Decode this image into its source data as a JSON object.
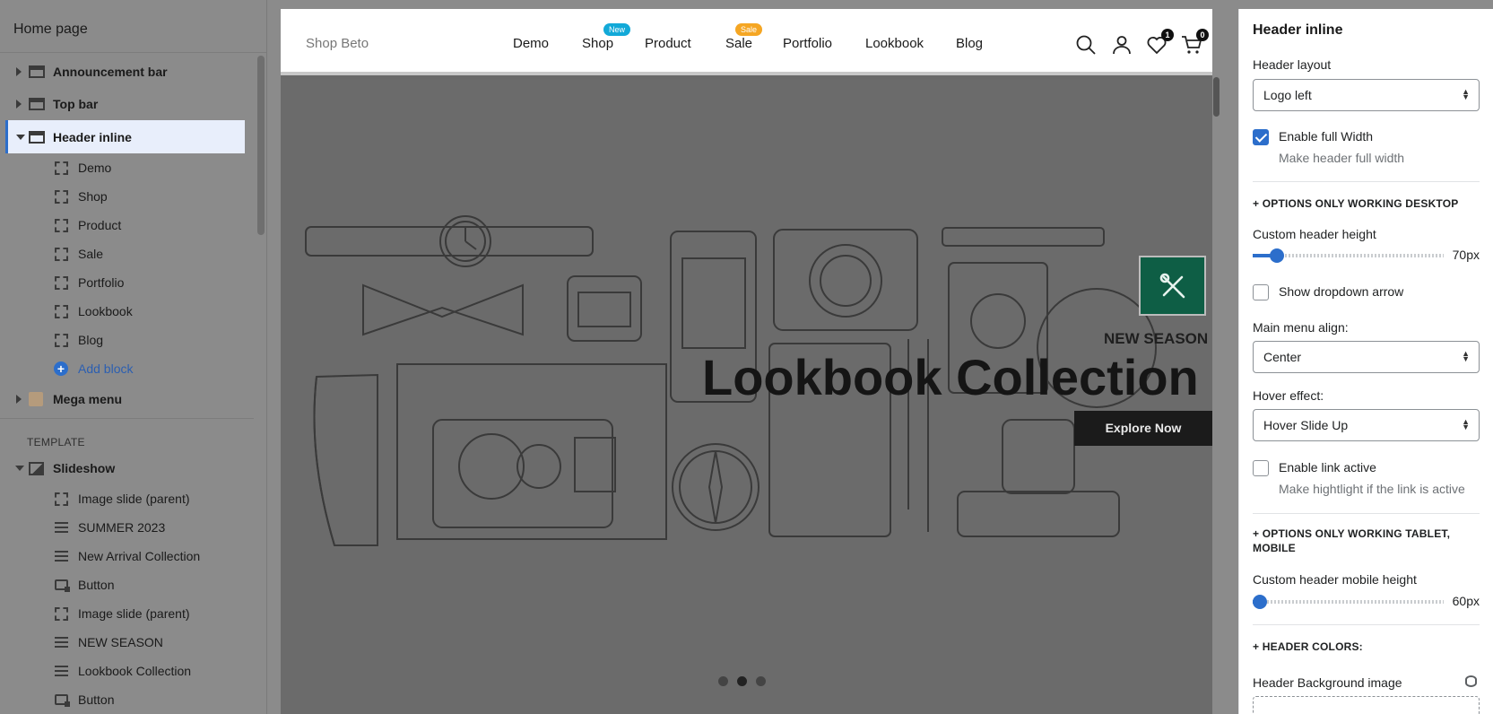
{
  "sidebar": {
    "title": "Home page",
    "add_block": "Add block",
    "template_label": "TEMPLATE",
    "sections": [
      "Announcement bar",
      "Top bar",
      "Header inline",
      "Mega menu",
      "Slideshow"
    ],
    "header_blocks": [
      "Demo",
      "Shop",
      "Product",
      "Sale",
      "Portfolio",
      "Lookbook",
      "Blog"
    ],
    "slideshow_blocks": [
      "Image slide (parent)",
      "SUMMER 2023",
      "New Arrival Collection",
      "Button",
      "Image slide (parent)",
      "NEW SEASON",
      "Lookbook Collection",
      "Button"
    ]
  },
  "preview": {
    "logo": "Shop Beto",
    "nav": [
      "Demo",
      "Shop",
      "Product",
      "Sale",
      "Portfolio",
      "Lookbook",
      "Blog"
    ],
    "badges": {
      "shop": "New",
      "sale": "Sale"
    },
    "badge_colors": {
      "shop": "#12a9d8",
      "sale": "#f5a623"
    },
    "wishlist_count": "1",
    "cart_count": "0",
    "hero": {
      "eyebrow": "NEW SEASON",
      "title": "Lookbook Collection",
      "cta": "Explore Now",
      "slide_count": 3,
      "active_slide": 2
    },
    "accent": "#0e5e45"
  },
  "panel": {
    "title": "Header inline",
    "header_layout_label": "Header layout",
    "header_layout_value": "Logo left",
    "full_width_label": "Enable full Width",
    "full_width_hint": "Make header full width",
    "full_width_checked": true,
    "desktop_heading": "+ OPTIONS ONLY WORKING DESKTOP",
    "header_height_label": "Custom header height",
    "header_height_value": "70px",
    "dropdown_arrow_label": "Show dropdown arrow",
    "menu_align_label": "Main menu align:",
    "menu_align_value": "Center",
    "hover_label": "Hover effect:",
    "hover_value": "Hover Slide Up",
    "link_active_label": "Enable link active",
    "link_active_hint": "Make hightlight if the link is active",
    "tablet_heading": "+ OPTIONS ONLY WORKING TABLET, MOBILE",
    "mobile_height_label": "Custom header mobile height",
    "mobile_height_value": "60px",
    "colors_heading": "+ HEADER COLORS:",
    "bg_image_label": "Header Background image",
    "accent": "#2c6ecb"
  }
}
